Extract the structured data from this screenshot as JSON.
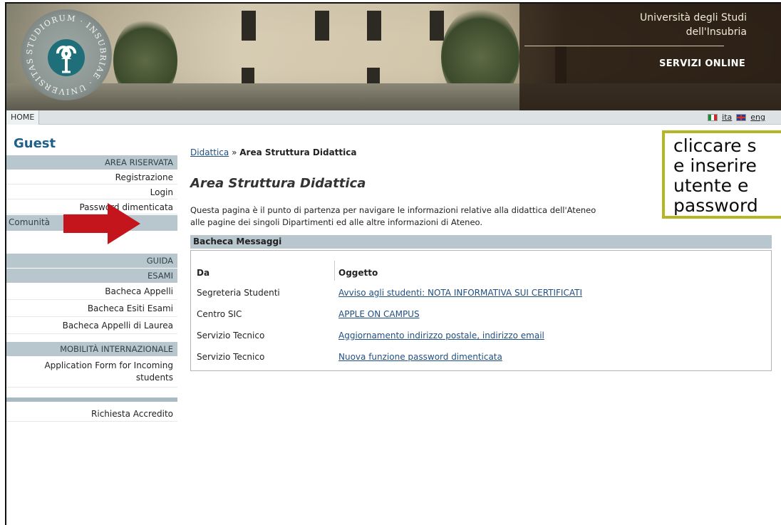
{
  "header": {
    "university_line1": "Università degli Studi",
    "university_line2": "dell'Insubria",
    "service": "SERVIZI ONLINE"
  },
  "navbar": {
    "home": "HOME",
    "lang_ita": "ita",
    "lang_eng": "eng"
  },
  "sidebar": {
    "user": "Guest",
    "area_riservata": "AREA RISERVATA",
    "registrazione": "Registrazione",
    "login": "Login",
    "password": "Password dimenticata",
    "comunita": "Comunità",
    "guida": "GUIDA",
    "esami": "ESAMI",
    "bacheca_appelli": "Bacheca Appelli",
    "bacheca_esiti": "Bacheca Esiti Esami",
    "bacheca_laurea": "Bacheca Appelli di Laurea",
    "mobilita": "MOBILITÀ INTERNAZIONALE",
    "application_form_line1": "Application Form for Incoming",
    "application_form_line2": "students",
    "richiesta": "Richiesta Accredito"
  },
  "main": {
    "breadcrumb_link": "Didattica",
    "breadcrumb_sep": " » ",
    "breadcrumb_current": "Area Struttura Didattica",
    "title": "Area Struttura Didattica",
    "intro_line1": "Questa pagina è il punto di partenza per navigare le informazioni relative alla didattica dell'Ateneo",
    "intro_line2": "alle pagine dei singoli Dipartimenti ed alle altre informazioni di Ateneo.",
    "bacheca_title": "Bacheca Messaggi",
    "col_da": "Da",
    "col_oggetto": "Oggetto",
    "rows": [
      {
        "da": "Segreteria Studenti",
        "oggetto": "Avviso agli studenti: NOTA INFORMATIVA SUI CERTIFICATI"
      },
      {
        "da": "Centro SIC",
        "oggetto": "APPLE ON CAMPUS"
      },
      {
        "da": "Servizio Tecnico",
        "oggetto": "Aggiornamento indirizzo postale, indirizzo email"
      },
      {
        "da": "Servizio Tecnico",
        "oggetto": "Nuova funzione password dimenticata"
      }
    ]
  },
  "callout": {
    "text": "cliccare s\ne inserire\nutente e\npassword"
  },
  "colors": {
    "accent_blue": "#1f5f8b",
    "sidebar_header": "#b8c7ce",
    "callout_border": "#b4b623",
    "arrow_red": "#c3151b"
  }
}
